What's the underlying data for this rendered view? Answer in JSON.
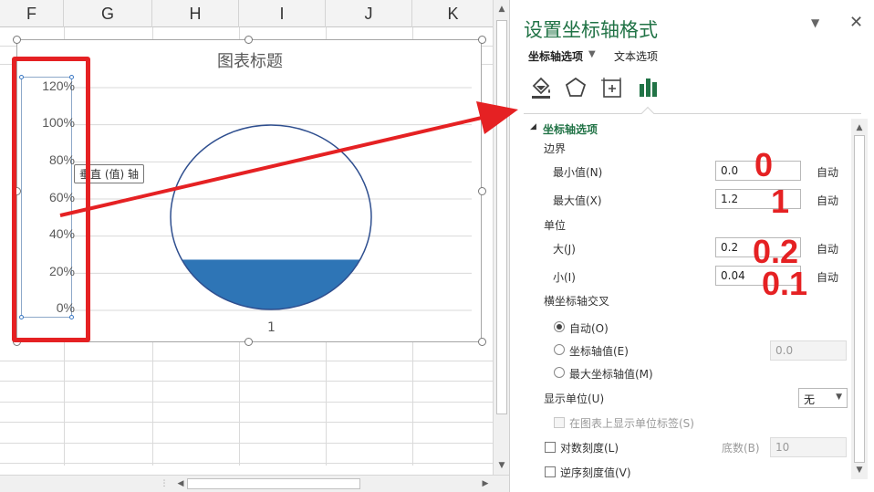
{
  "sheet": {
    "columns": [
      "F",
      "G",
      "H",
      "I",
      "J",
      "K"
    ]
  },
  "chart": {
    "title": "图表标题",
    "axis_tooltip": "垂直 (值) 轴",
    "category_label": "1",
    "y_ticks": [
      "120%",
      "100%",
      "80%",
      "60%",
      "40%",
      "20%",
      "0%"
    ]
  },
  "chart_data": {
    "type": "area",
    "title": "图表标题",
    "categories": [
      "1"
    ],
    "y_tick_labels": [
      "0%",
      "20%",
      "40%",
      "60%",
      "80%",
      "100%",
      "120%"
    ],
    "ylim": [
      0,
      1.2
    ],
    "fill_level": 0.27,
    "fill_color": "#2e75b6",
    "outline": "circle",
    "grid": true
  },
  "pane": {
    "title": "设置坐标轴格式",
    "tab_axis": "坐标轴选项",
    "tab_text": "文本选项",
    "section": "坐标轴选项",
    "bounds_label": "边界",
    "min_label": "最小值(N)",
    "min_value": "0.0",
    "max_label": "最大值(X)",
    "max_value": "1.2",
    "units_label": "单位",
    "major_label": "大(J)",
    "major_value": "0.2",
    "minor_label": "小(I)",
    "minor_value": "0.04",
    "auto": "自动",
    "cross_label": "横坐标轴交叉",
    "cross_auto": "自动(O)",
    "cross_value_label": "坐标轴值(E)",
    "cross_value": "0.0",
    "cross_max_label": "最大坐标轴值(M)",
    "display_units_label": "显示单位(U)",
    "display_units_value": "无",
    "show_units_label": "在图表上显示单位标签(S)",
    "log_label": "对数刻度(L)",
    "base_label": "底数(B)",
    "base_value": "10",
    "reverse_label": "逆序刻度值(V)"
  },
  "annotations": {
    "min": "0",
    "max": "1",
    "major": "0.2",
    "minor": "0.1",
    "color": "#e52123"
  },
  "colors": {
    "accent": "#217346",
    "series": "#2e75b6",
    "annotation": "#e52123"
  }
}
